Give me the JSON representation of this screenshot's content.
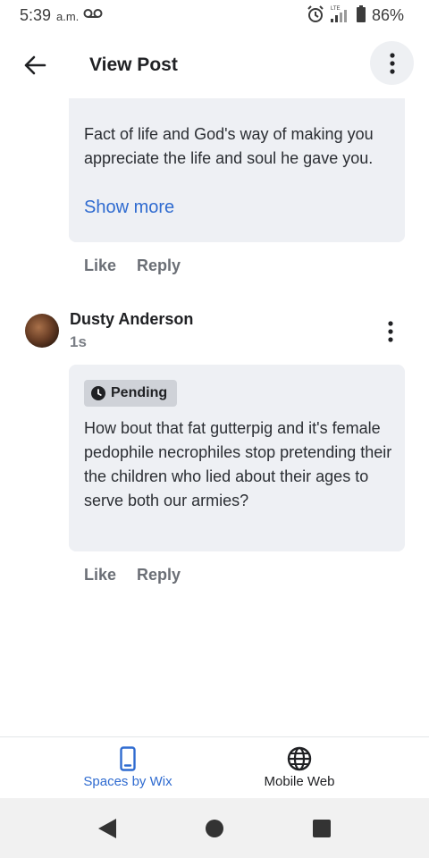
{
  "status_bar": {
    "time": "5:39",
    "ampm": "a.m.",
    "battery_percent": "86%",
    "signal_label": "LTE",
    "icons": [
      "voicemail-icon",
      "alarm-icon",
      "signal-icon",
      "battery-icon"
    ]
  },
  "app_bar": {
    "title": "View Post",
    "icons": [
      "arrow-left-icon",
      "more-vertical-icon"
    ]
  },
  "comments": [
    {
      "text": "Fact of life and God's way of making you appreciate the life and soul he gave you.",
      "show_more_label": "Show more",
      "actions": {
        "like": "Like",
        "reply": "Reply"
      }
    },
    {
      "author": "Dusty Anderson",
      "timestamp": "1s",
      "status_label": "Pending",
      "text": "How bout that fat gutterpig and it's female pedophile necrophiles stop pretending their the children who lied about their ages to serve both our armies?",
      "actions": {
        "like": "Like",
        "reply": "Reply"
      }
    }
  ],
  "tab_bar": {
    "tabs": [
      {
        "label": "Spaces by Wix",
        "icon": "phone-icon",
        "active": true
      },
      {
        "label": "Mobile Web",
        "icon": "globe-icon",
        "active": false
      }
    ]
  },
  "colors": {
    "accent": "#2f6bd0",
    "bubble_bg": "#eef0f4",
    "badge_bg": "#cfd2d8",
    "action_text": "#6b6f76"
  },
  "nav_bar": {
    "icons": [
      "nav-back-icon",
      "nav-home-icon",
      "nav-recents-icon"
    ]
  }
}
